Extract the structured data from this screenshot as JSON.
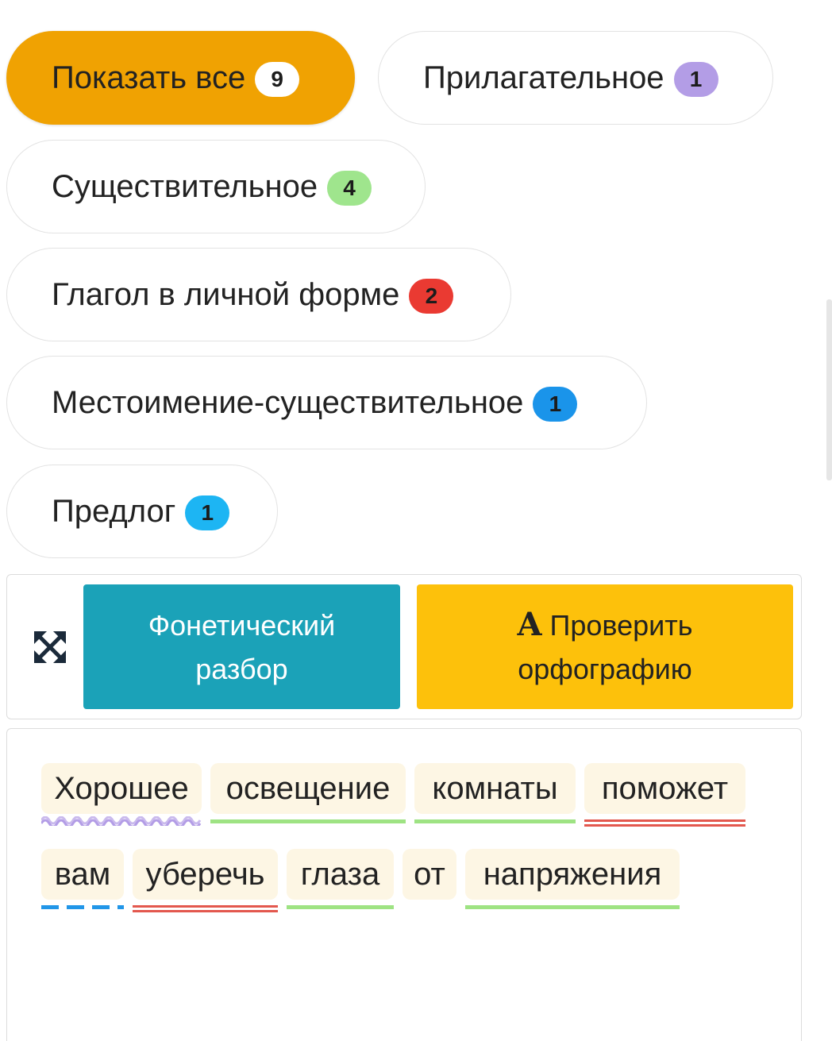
{
  "filters": [
    {
      "label": "Показать все",
      "count": "9",
      "badge_color": "#ffffff",
      "active": true
    },
    {
      "label": "Прилагательное",
      "count": "1",
      "badge_color": "#b39de6",
      "active": false
    },
    {
      "label": "Существительное",
      "count": "4",
      "badge_color": "#9fe58d",
      "active": false
    },
    {
      "label": "Глагол в личной форме",
      "count": "2",
      "badge_color": "#ea3a32",
      "active": false
    },
    {
      "label": "Местоимение-существительное",
      "count": "1",
      "badge_color": "#1a94ea",
      "active": false
    },
    {
      "label": "Предлог",
      "count": "1",
      "badge_color": "#1db5f3",
      "active": false
    }
  ],
  "toolbar": {
    "expand_icon": "expand-arrows-icon",
    "phonetic_line1": "Фонетический",
    "phonetic_line2": "разбор",
    "spell_icon_glyph": "A",
    "spell_line1": "Проверить",
    "spell_line2": "орфографию"
  },
  "colors": {
    "active_filter": "#f0a202",
    "phonetic_button": "#1ba2b8",
    "spell_button": "#fdc10b",
    "word_background": "#fdf6e4",
    "noun_underline": "#9ee383",
    "verb_underline": "#e3584e",
    "pronoun_underline": "#2196e8",
    "adjective_underline": "#b39de6"
  },
  "sentence": {
    "words": [
      {
        "text": "Хорошее",
        "pos": "adjective"
      },
      {
        "text": "освещение",
        "pos": "noun"
      },
      {
        "text": "комнаты",
        "pos": "noun"
      },
      {
        "text": "поможет",
        "pos": "verb"
      },
      {
        "text": "вам",
        "pos": "pronoun"
      },
      {
        "text": "уберечь",
        "pos": "verb"
      },
      {
        "text": "глаза",
        "pos": "noun"
      },
      {
        "text": "от",
        "pos": "preposition"
      },
      {
        "text": "напряжения",
        "pos": "noun"
      }
    ]
  }
}
